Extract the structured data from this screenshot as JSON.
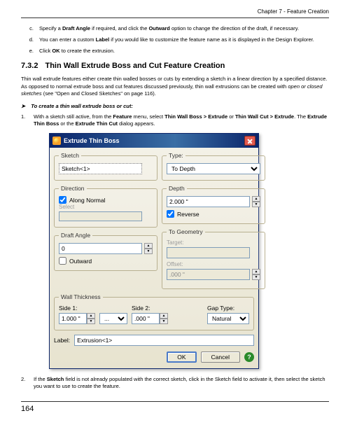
{
  "chapter_header": "Chapter 7 - Feature Creation",
  "pre_list": {
    "c": {
      "letter": "c.",
      "text_before": "Specify a ",
      "bold1": "Draft Angle",
      "text_mid": " if required, and click the ",
      "bold2": "Outward",
      "text_after": " option to change the direction of the draft, if necessary."
    },
    "d": {
      "letter": "d.",
      "text_before": "You can enter a custom ",
      "bold1": "Label",
      "text_after": " if you would like to customize the feature name as it is displayed in the Design Explorer."
    },
    "e": {
      "letter": "e.",
      "text_before": "Click ",
      "bold1": "OK",
      "text_after": " to create the extrusion."
    }
  },
  "section": {
    "number": "7.3.2",
    "title": "Thin Wall Extrude Boss and Cut Feature Creation"
  },
  "intro": {
    "t1": "Thin wall extrude features either create thin walled bosses or cuts by extending a sketch in a linear direction by a specified distance. As opposed to normal extrude boss and cut features discussed previously, thin wall extrusions can be created with ",
    "i1": "open or closed sketches",
    "t2": " (see \"Open and Closed Sketches\" on page 116)."
  },
  "step_heading": {
    "bullet": "➤",
    "text": "To create a thin wall extrude boss or cut:"
  },
  "step1": {
    "num": "1.",
    "t1": "With a sketch still active, from the ",
    "b1": "Feature",
    "t2": " menu, select ",
    "b2": "Thin Wall Boss > Extrude",
    "t3": " or ",
    "b3": "Thin Wall Cut > Extrude",
    "t4": ". The ",
    "b4": "Extrude Thin Boss",
    "t5": " or the ",
    "b5": "Extrude Thin Cut",
    "t6": " dialog appears."
  },
  "dialog": {
    "title": "Extrude Thin Boss",
    "sketch_legend": "Sketch",
    "sketch_value": "Sketch<1>",
    "direction_legend": "Direction",
    "along_normal_label": "Along Normal",
    "along_normal_checked": true,
    "select_label": "Select",
    "select_value": "",
    "draft_legend": "Draft Angle",
    "draft_value": "0",
    "outward_label": "Outward",
    "outward_checked": false,
    "type_legend": "Type:",
    "type_value": "To Depth",
    "depth_legend": "Depth",
    "depth_value": "2.000 \"",
    "reverse_label": "Reverse",
    "reverse_checked": true,
    "togeom_legend": "To Geometry",
    "target_label": "Target:",
    "target_value": "",
    "offset_label": "Offset:",
    "offset_value": ".000 \"",
    "wall_legend": "Wall Thickness",
    "side1_label": "Side 1:",
    "side1_value": "1.000 \"",
    "side2_label": "Side 2:",
    "side2_value": ".000 \"",
    "gap_label": "Gap Type:",
    "gap_value": "Natural",
    "label_label": "Label:",
    "label_value": "Extrusion<1>",
    "ok": "OK",
    "cancel": "Cancel"
  },
  "step2": {
    "num": "2.",
    "t1": "If the ",
    "b1": "Sketch",
    "t2": " field is not already populated with the correct sketch, click in the Sketch field to activate it, then select the sketch you want to use to create the feature."
  },
  "page_number": "164"
}
